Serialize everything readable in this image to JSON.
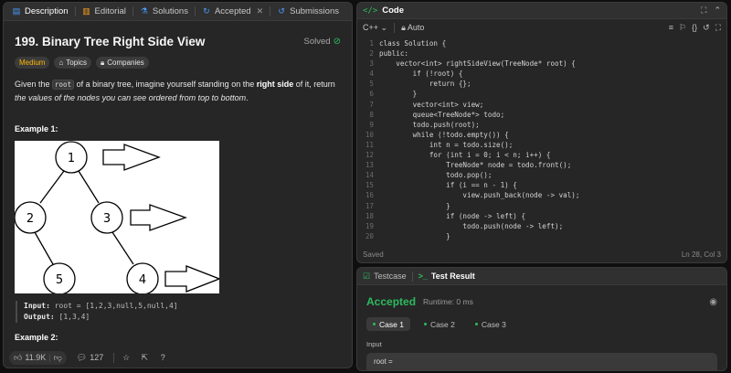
{
  "left_tabs": [
    {
      "label": "Description",
      "icon": "description-icon"
    },
    {
      "label": "Editorial",
      "icon": "editorial-icon"
    },
    {
      "label": "Solutions",
      "icon": "solutions-icon"
    },
    {
      "label": "Accepted",
      "icon": "accepted-icon"
    },
    {
      "label": "Submissions",
      "icon": "submissions-icon"
    }
  ],
  "problem": {
    "title": "199. Binary Tree Right Side View",
    "status": "Solved",
    "difficulty": "Medium",
    "topics": "Topics",
    "companies": "Companies",
    "text_1": "Given the ",
    "code_root": "root",
    "text_2": " of a binary tree, imagine yourself standing on the ",
    "bold_right_side": "right side",
    "text_3": " of it, return ",
    "italic_tail": "the values of the nodes you can see ordered from top to bottom",
    "text_4": ".",
    "example1_title": "Example 1:",
    "tree_nodes": [
      "1",
      "2",
      "3",
      "5",
      "4"
    ],
    "input_label": "Input:",
    "input_value": " root = [1,2,3,null,5,null,4]",
    "output_label": "Output:",
    "output_value": " [1,3,4]",
    "example2_title": "Example 2:"
  },
  "bottom": {
    "likes": "11.9K",
    "comments": "127"
  },
  "editor": {
    "title": "Code",
    "language": "C++",
    "mode": "Auto",
    "status_left": "Saved",
    "status_right": "Ln 28, Col 3",
    "lines": [
      {
        "n": "1",
        "code": "class Solution {"
      },
      {
        "n": "2",
        "code": "public:"
      },
      {
        "n": "3",
        "code": "    vector<int> rightSideView(TreeNode* root) {"
      },
      {
        "n": "4",
        "code": "        if (!root) {"
      },
      {
        "n": "5",
        "code": "            return {};"
      },
      {
        "n": "6",
        "code": "        }"
      },
      {
        "n": "7",
        "code": "        vector<int> view;"
      },
      {
        "n": "8",
        "code": "        queue<TreeNode*> todo;"
      },
      {
        "n": "9",
        "code": "        todo.push(root);"
      },
      {
        "n": "10",
        "code": "        while (!todo.empty()) {"
      },
      {
        "n": "11",
        "code": "            int n = todo.size();"
      },
      {
        "n": "12",
        "code": "            for (int i = 0; i < n; i++) {"
      },
      {
        "n": "13",
        "code": "                TreeNode* node = todo.front();"
      },
      {
        "n": "14",
        "code": "                todo.pop();"
      },
      {
        "n": "15",
        "code": "                if (i == n - 1) {"
      },
      {
        "n": "16",
        "code": "                    view.push_back(node -> val);"
      },
      {
        "n": "17",
        "code": "                }"
      },
      {
        "n": "18",
        "code": "                if (node -> left) {"
      },
      {
        "n": "19",
        "code": "                    todo.push(node -> left);"
      },
      {
        "n": "20",
        "code": "                }"
      }
    ]
  },
  "result": {
    "tab_testcase": "Testcase",
    "tab_result": "Test Result",
    "verdict": "Accepted",
    "runtime": "Runtime: 0 ms",
    "cases": [
      "Case 1",
      "Case 2",
      "Case 3"
    ],
    "input_label": "Input",
    "input_value": "root ="
  },
  "colors": {
    "accent_green": "#2cbb5d",
    "medium": "#ffb800",
    "panel": "#262626"
  }
}
